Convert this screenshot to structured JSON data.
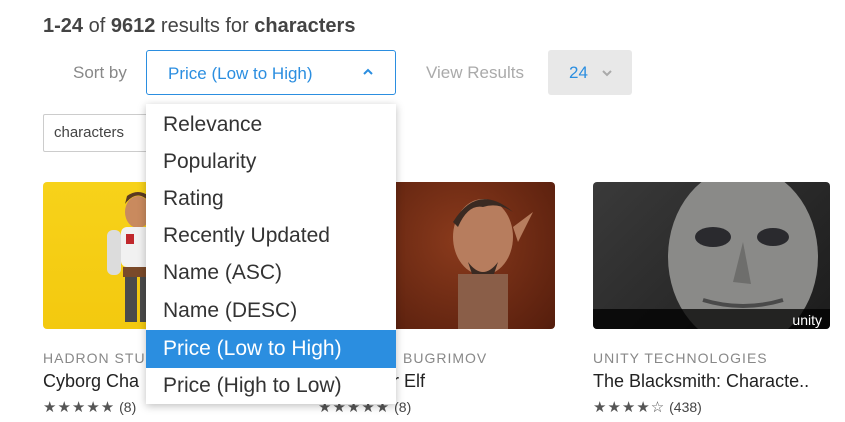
{
  "header": {
    "range": "1-24",
    "of_text": "of",
    "total": "9612",
    "results_text": "results for",
    "query": "characters"
  },
  "sort": {
    "label": "Sort by",
    "selected": "Price (Low to High)",
    "options": [
      "Relevance",
      "Popularity",
      "Rating",
      "Recently Updated",
      "Name (ASC)",
      "Name (DESC)",
      "Price (Low to High)",
      "Price (High to Low)"
    ],
    "selected_index": 6
  },
  "view": {
    "label": "View Results",
    "value": "24"
  },
  "search_chip": {
    "text": "characters"
  },
  "cards": [
    {
      "publisher": "HADRON STU",
      "title": "Cyborg Cha",
      "stars": "★★★★★",
      "reviews": "(8)"
    },
    {
      "publisher": "BUGRIMOV",
      "title": "r Elf",
      "stars": "★★★★★",
      "reviews": "(8)"
    },
    {
      "publisher": "UNITY TECHNOLOGIES",
      "title": "The Blacksmith: Characte..",
      "stars": "★★★★☆",
      "reviews": "(438)",
      "badge": "unity"
    }
  ],
  "colors": {
    "accent": "#2b8ee0",
    "muted": "#888888"
  },
  "icons": {
    "sort_chevron": "chevron-up-icon",
    "view_chevron": "chevron-down-icon"
  }
}
